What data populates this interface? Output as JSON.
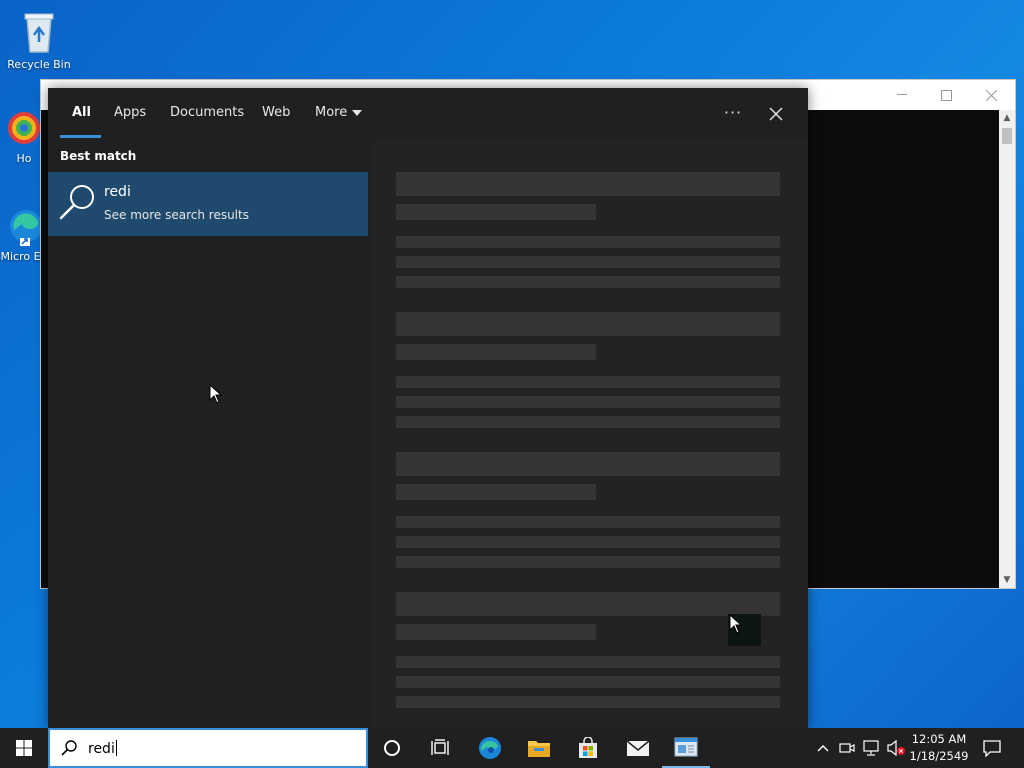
{
  "desktop": {
    "icons": [
      {
        "label": "Recycle Bin"
      },
      {
        "label": "Ho"
      },
      {
        "label": "Micro Ed"
      }
    ]
  },
  "search_panel": {
    "tabs": [
      {
        "label": "All",
        "active": true
      },
      {
        "label": "Apps"
      },
      {
        "label": "Documents"
      },
      {
        "label": "Web"
      },
      {
        "label": "More"
      }
    ],
    "best_match_label": "Best match",
    "best_match": {
      "title": "redi",
      "subtitle": "See more search results"
    }
  },
  "taskbar": {
    "search_value": "redi",
    "clock": {
      "time": "12:05 AM",
      "date": "1/18/2549"
    }
  },
  "colors": {
    "accent": "#3b8fd6",
    "panel_bg": "#202020",
    "selection_bg": "#1f4a6e"
  }
}
